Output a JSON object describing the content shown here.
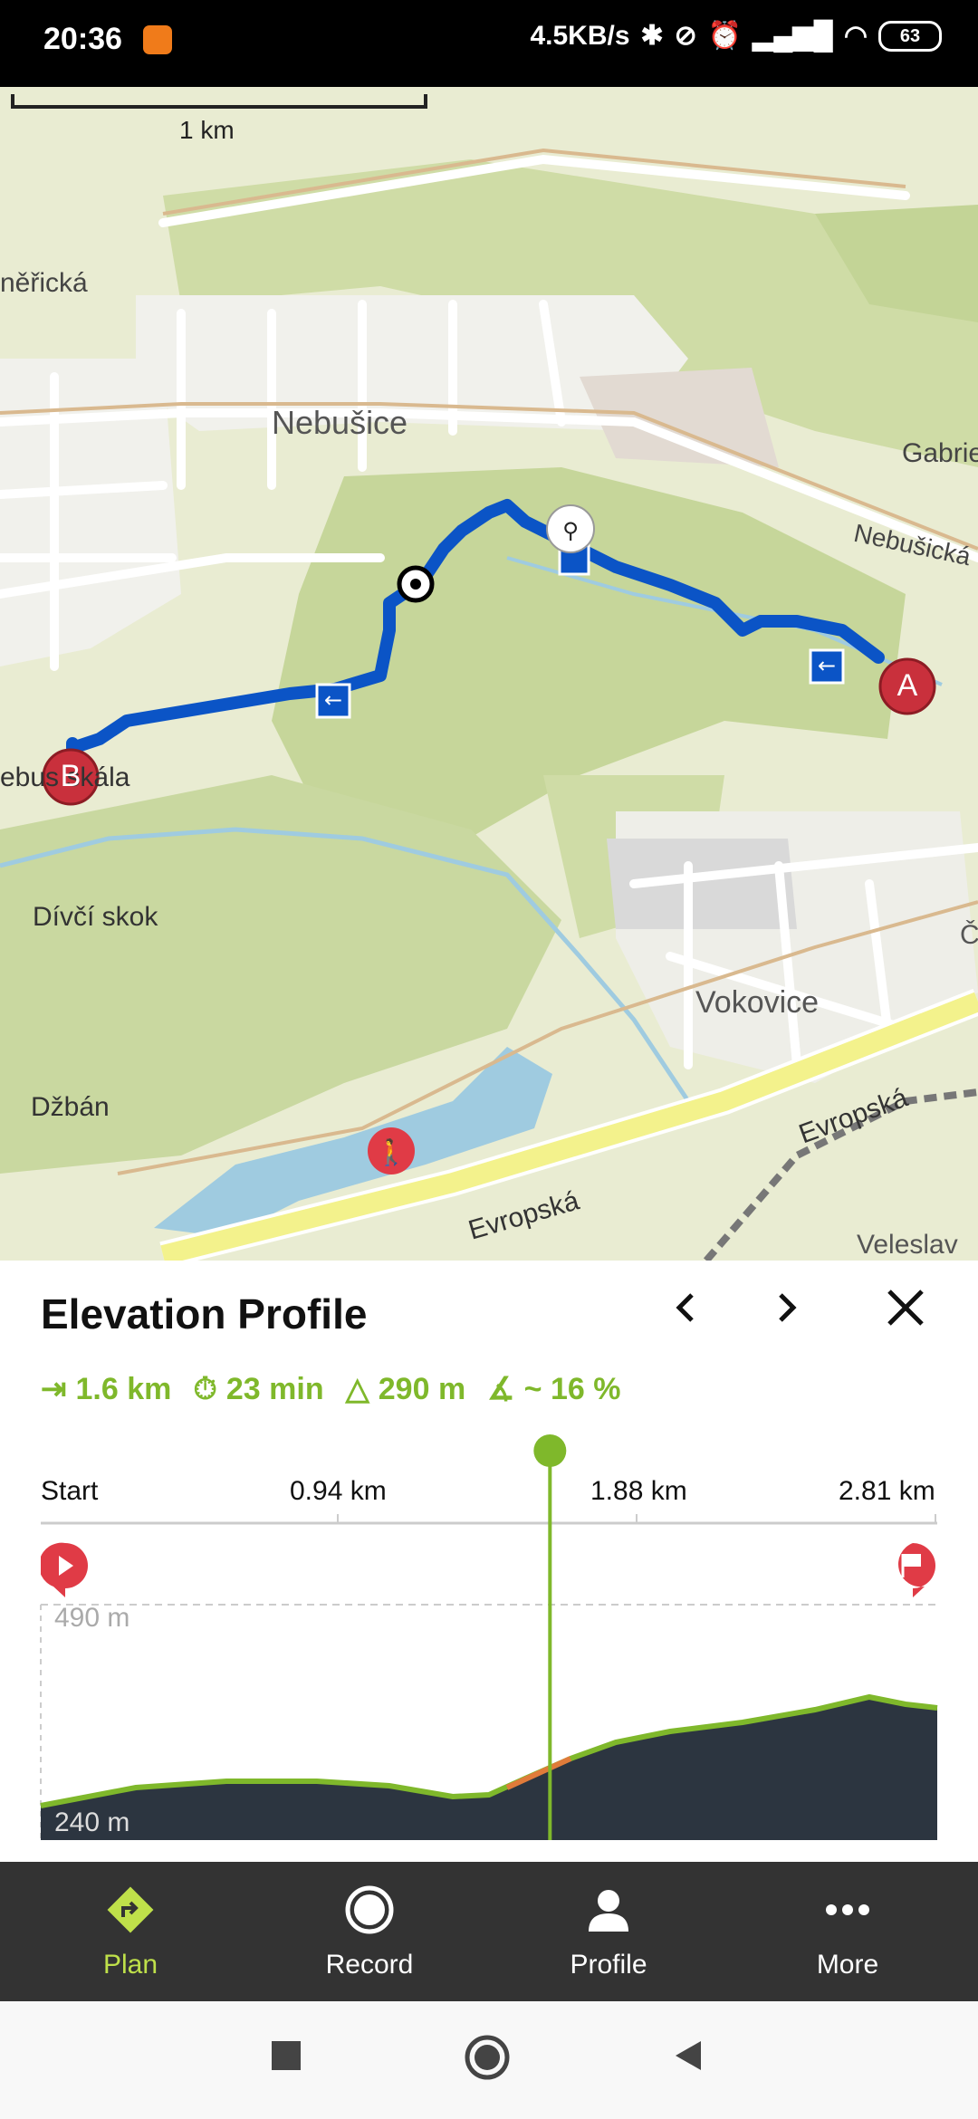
{
  "status_bar": {
    "time": "20:36",
    "network_speed": "4.5KB/s",
    "battery": "63"
  },
  "map": {
    "scale_label": "1 km",
    "labels": {
      "nebusice": "Nebušice",
      "nericka": "něřická",
      "gabrie": "Gabrie",
      "nebusicka": "Nebušická",
      "skala": "ebus skála",
      "divci_skok": "Dívčí skok",
      "vokovice": "Vokovice",
      "dzban": "Džbán",
      "evropska_1": "Evropská",
      "evropska_2": "Evropská",
      "veleslav": "Veleslav",
      "partial_c": "Č"
    },
    "markers": {
      "start": "A",
      "end": "B"
    }
  },
  "elevation": {
    "title": "Elevation Profile",
    "stats": {
      "distance": "1.6 km",
      "time": "23 min",
      "ascent": "290 m",
      "slope": "~ 16 %"
    },
    "x_labels": [
      "Start",
      "0.94 km",
      "1.88 km",
      "2.81 km"
    ],
    "y_top": "490 m",
    "y_bottom": "240 m",
    "cursor_fraction": 0.568,
    "colors": {
      "accent": "#7fb82b",
      "profile_fill": "#2c3540",
      "marker_red": "#e03b46"
    }
  },
  "nav": {
    "items": [
      {
        "label": "Plan",
        "icon": "plan-icon",
        "active": true
      },
      {
        "label": "Record",
        "icon": "record-icon",
        "active": false
      },
      {
        "label": "Profile",
        "icon": "profile-icon",
        "active": false
      },
      {
        "label": "More",
        "icon": "more-icon",
        "active": false
      }
    ]
  }
}
